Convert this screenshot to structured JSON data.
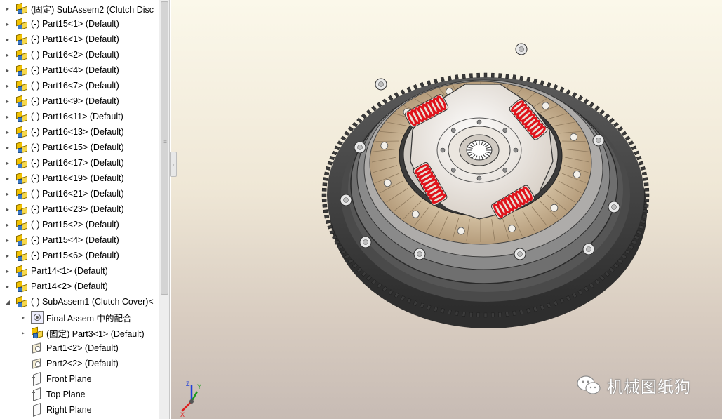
{
  "feature_tree": {
    "items": [
      {
        "label": "(固定) SubAssem2 (Clutch Disc",
        "icon": "subassembly-icon",
        "expander": "▸"
      },
      {
        "label": "(-) Part15<1> (Default)",
        "icon": "assembly-part-icon",
        "expander": "▸"
      },
      {
        "label": "(-) Part16<1> (Default)",
        "icon": "assembly-part-icon",
        "expander": "▸"
      },
      {
        "label": "(-) Part16<2> (Default)",
        "icon": "assembly-part-icon",
        "expander": "▸"
      },
      {
        "label": "(-) Part16<4> (Default)",
        "icon": "assembly-part-icon",
        "expander": "▸"
      },
      {
        "label": "(-) Part16<7> (Default)",
        "icon": "assembly-part-icon",
        "expander": "▸"
      },
      {
        "label": "(-) Part16<9> (Default)",
        "icon": "assembly-part-icon",
        "expander": "▸"
      },
      {
        "label": "(-) Part16<11> (Default)",
        "icon": "assembly-part-icon",
        "expander": "▸"
      },
      {
        "label": "(-) Part16<13> (Default)",
        "icon": "assembly-part-icon",
        "expander": "▸"
      },
      {
        "label": "(-) Part16<15> (Default)",
        "icon": "assembly-part-icon",
        "expander": "▸"
      },
      {
        "label": "(-) Part16<17> (Default)",
        "icon": "assembly-part-icon",
        "expander": "▸"
      },
      {
        "label": "(-) Part16<19> (Default)",
        "icon": "assembly-part-icon",
        "expander": "▸"
      },
      {
        "label": "(-) Part16<21> (Default)",
        "icon": "assembly-part-icon",
        "expander": "▸"
      },
      {
        "label": "(-) Part16<23> (Default)",
        "icon": "assembly-part-icon",
        "expander": "▸"
      },
      {
        "label": "(-) Part15<2> (Default)",
        "icon": "assembly-part-icon",
        "expander": "▸"
      },
      {
        "label": "(-) Part15<4> (Default)",
        "icon": "assembly-part-icon",
        "expander": "▸"
      },
      {
        "label": "(-) Part15<6> (Default)",
        "icon": "assembly-part-icon",
        "expander": "▸"
      },
      {
        "label": "Part14<1> (Default)",
        "icon": "assembly-part-icon",
        "expander": "▸"
      },
      {
        "label": "Part14<2> (Default)",
        "icon": "assembly-part-icon",
        "expander": "▸"
      },
      {
        "label": "(-) SubAssem1 (Clutch Cover)<",
        "icon": "subassembly-icon",
        "expander": "◢"
      },
      {
        "label": "Final Assem 中的配合",
        "icon": "mates-icon",
        "expander": "▸"
      },
      {
        "label": "(固定) Part3<1> (Default)",
        "icon": "assembly-part-icon",
        "expander": "▸"
      },
      {
        "label": "Part1<2> (Default)",
        "icon": "part-icon",
        "expander": ""
      },
      {
        "label": "Part2<2> (Default)",
        "icon": "part-icon",
        "expander": ""
      },
      {
        "label": "Front Plane",
        "icon": "plane-icon",
        "expander": ""
      },
      {
        "label": "Top Plane",
        "icon": "plane-icon",
        "expander": ""
      },
      {
        "label": "Right Plane",
        "icon": "plane-icon",
        "expander": ""
      }
    ]
  },
  "graphics": {
    "triad": {
      "x_label": "X",
      "y_label": "Y",
      "z_label": "Z"
    },
    "colors": {
      "ring_gear": "#3a3a3a",
      "friction_lining": "#c9b59a",
      "springs": "#e0141c",
      "hub_plate": "#f1ece6",
      "cover": "#6e6e6e"
    }
  },
  "watermark": {
    "text": "机械图纸狗",
    "icon": "wechat-icon"
  }
}
